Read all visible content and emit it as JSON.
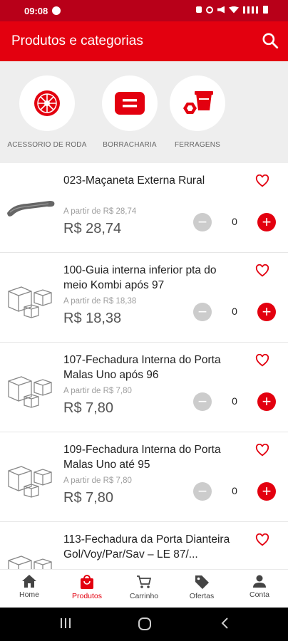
{
  "status": {
    "time": "09:08"
  },
  "header": {
    "title": "Produtos e categorias"
  },
  "categories": [
    {
      "label": "ACESSORIO DE RODA",
      "icon": "wheel-icon"
    },
    {
      "label": "BORRACHARIA",
      "icon": "rubber-icon"
    },
    {
      "label": "FERRAGENS",
      "icon": "hardware-icon"
    }
  ],
  "products": [
    {
      "name": "023-Maçaneta Externa Rural",
      "from": "A partir de R$ 28,74",
      "price": "R$ 28,74",
      "qty": "0"
    },
    {
      "name": "100-Guia interna inferior pta do meio  Kombi após 97",
      "from": "A partir de R$ 18,38",
      "price": "R$ 18,38",
      "qty": "0"
    },
    {
      "name": "107-Fechadura Interna do Porta Malas Uno após 96",
      "from": "A partir de R$ 7,80",
      "price": "R$ 7,80",
      "qty": "0"
    },
    {
      "name": "109-Fechadura Interna do Porta Malas Uno até 95",
      "from": "A partir de R$ 7,80",
      "price": "R$ 7,80",
      "qty": "0"
    },
    {
      "name": "113-Fechadura da Porta Dianteira Gol/Voy/Par/Sav – LE 87/...",
      "from": "",
      "price": "",
      "qty": ""
    }
  ],
  "nav": [
    {
      "label": "Home",
      "icon": "home-icon"
    },
    {
      "label": "Produtos",
      "icon": "bag-icon"
    },
    {
      "label": "Carrinho",
      "icon": "cart-icon"
    },
    {
      "label": "Ofertas",
      "icon": "tag-icon"
    },
    {
      "label": "Conta",
      "icon": "person-icon"
    }
  ],
  "colors": {
    "brand": "#e3000f",
    "statusbar": "#b80019"
  }
}
